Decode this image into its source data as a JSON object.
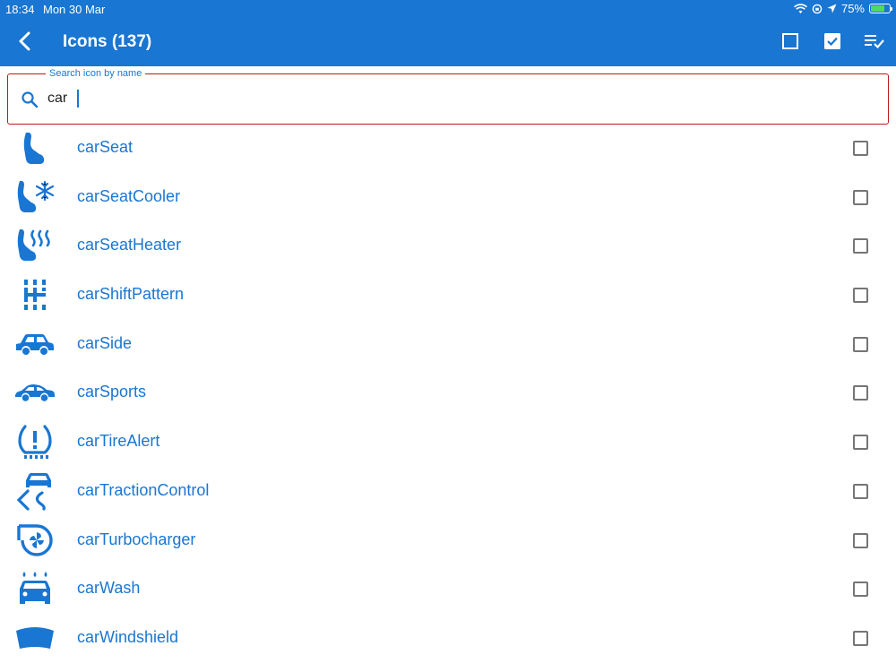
{
  "status": {
    "time": "18:34",
    "date": "Mon 30 Mar",
    "battery": "75%",
    "battery_level": 0.75
  },
  "toolbar": {
    "title": "Icons (137)",
    "back_icon": "chevron-left-icon",
    "select_none_icon": "checkbox-outline-icon",
    "select_all_icon": "checkbox-checked-icon",
    "select_list_icon": "playlist-check-icon"
  },
  "search": {
    "label": "Search icon by name",
    "value": "car",
    "icon": "search-icon"
  },
  "colors": {
    "primary": "#1976d2",
    "error_border": "#b71c1c",
    "checkbox": "#757575"
  },
  "items": [
    {
      "label": "carSeat",
      "icon": "car-seat-icon",
      "checked": false
    },
    {
      "label": "carSeatCooler",
      "icon": "car-seat-cooler-icon",
      "checked": false
    },
    {
      "label": "carSeatHeater",
      "icon": "car-seat-heater-icon",
      "checked": false
    },
    {
      "label": "carShiftPattern",
      "icon": "car-shift-pattern-icon",
      "checked": false
    },
    {
      "label": "carSide",
      "icon": "car-side-icon",
      "checked": false
    },
    {
      "label": "carSports",
      "icon": "car-sports-icon",
      "checked": false
    },
    {
      "label": "carTireAlert",
      "icon": "car-tire-alert-icon",
      "checked": false
    },
    {
      "label": "carTractionControl",
      "icon": "car-traction-control-icon",
      "checked": false
    },
    {
      "label": "carTurbocharger",
      "icon": "car-turbocharger-icon",
      "checked": false
    },
    {
      "label": "carWash",
      "icon": "car-wash-icon",
      "checked": false
    },
    {
      "label": "carWindshield",
      "icon": "car-windshield-icon",
      "checked": false
    }
  ]
}
